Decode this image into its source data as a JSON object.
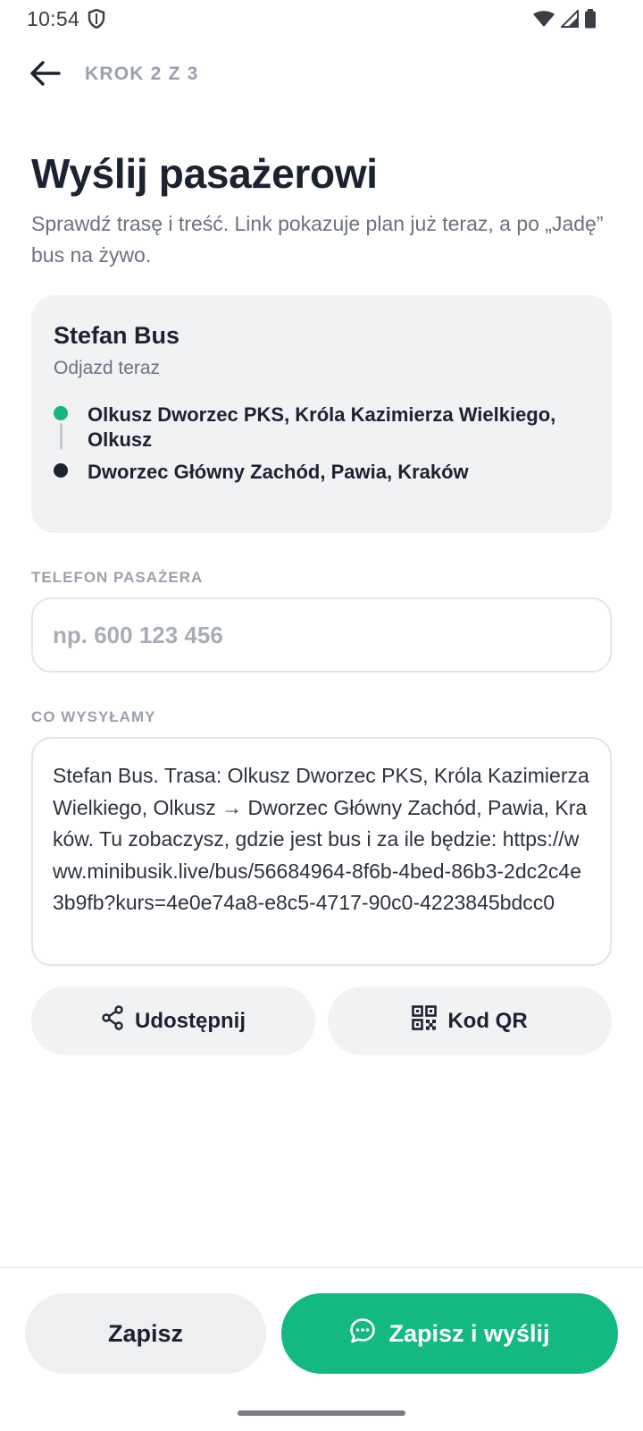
{
  "status_bar": {
    "time": "10:54",
    "icons": [
      "shield-icon",
      "wifi-icon",
      "signal-icon",
      "battery-icon"
    ]
  },
  "header": {
    "step": "KROK 2 Z 3",
    "back_icon": "arrow-left-icon"
  },
  "page": {
    "title": "Wyślij pasażerowi",
    "subtitle": "Sprawdź trasę i treść. Link pokazuje plan już teraz, a po „Jadę” bus na żywo."
  },
  "route": {
    "operator": "Stefan Bus",
    "departure": "Odjazd teraz",
    "from": "Olkusz Dworzec PKS, Króla Kazimierza Wielkiego, Olkusz",
    "to": "Dworzec Główny Zachód, Pawia, Kraków"
  },
  "phone": {
    "label": "TELEFON PASAŻERA",
    "placeholder": "np. 600 123 456",
    "value": ""
  },
  "message": {
    "label": "CO WYSYŁAMY",
    "text": "Stefan Bus. Trasa: Olkusz Dworzec PKS, Króla Kazimierza Wielkiego, Olkusz → Dworzec Główny Zachód, Pawia, Kraków. Tu zobaczysz, gdzie jest bus i za ile będzie: https://www.minibusik.live/bus/56684964-8f6b-4bed-86b3-2dc2c4e3b9fb?kurs=4e0e74a8-e8c5-4717-90c0-4223845bdcc0"
  },
  "actions": {
    "share_label": "Udostępnij",
    "share_icon": "share-icon",
    "qr_label": "Kod QR",
    "qr_icon": "qr-code-icon"
  },
  "footer": {
    "save_label": "Zapisz",
    "send_label": "Zapisz i wyślij",
    "send_icon": "chat-bubble-icon"
  },
  "colors": {
    "accent": "#13b97f",
    "origin_dot": "#18b67a",
    "destination_dot": "#1b2230",
    "card_bg": "#f1f2f4",
    "muted_text": "#9aa1ab"
  }
}
